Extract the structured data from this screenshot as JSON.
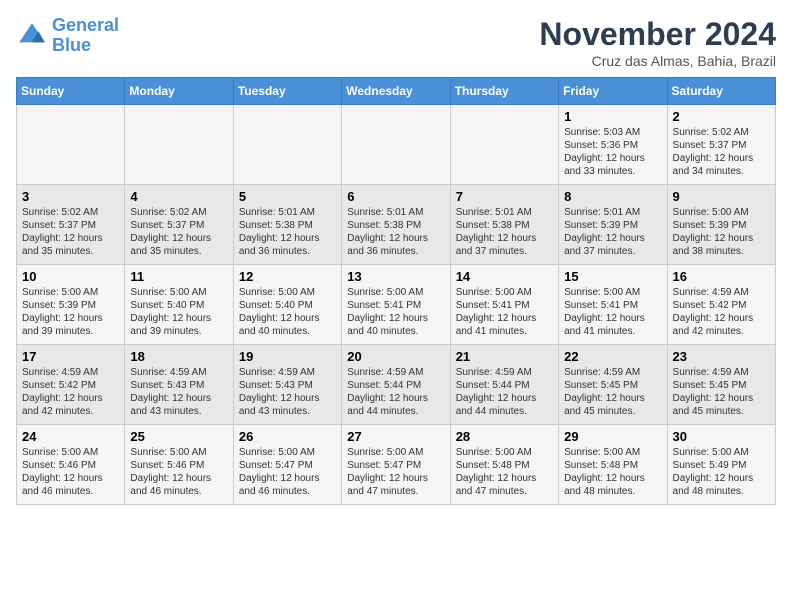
{
  "logo": {
    "line1": "General",
    "line2": "Blue"
  },
  "header": {
    "month": "November 2024",
    "location": "Cruz das Almas, Bahia, Brazil"
  },
  "weekdays": [
    "Sunday",
    "Monday",
    "Tuesday",
    "Wednesday",
    "Thursday",
    "Friday",
    "Saturday"
  ],
  "weeks": [
    [
      {
        "day": "",
        "info": ""
      },
      {
        "day": "",
        "info": ""
      },
      {
        "day": "",
        "info": ""
      },
      {
        "day": "",
        "info": ""
      },
      {
        "day": "",
        "info": ""
      },
      {
        "day": "1",
        "info": "Sunrise: 5:03 AM\nSunset: 5:36 PM\nDaylight: 12 hours and 33 minutes."
      },
      {
        "day": "2",
        "info": "Sunrise: 5:02 AM\nSunset: 5:37 PM\nDaylight: 12 hours and 34 minutes."
      }
    ],
    [
      {
        "day": "3",
        "info": "Sunrise: 5:02 AM\nSunset: 5:37 PM\nDaylight: 12 hours and 35 minutes."
      },
      {
        "day": "4",
        "info": "Sunrise: 5:02 AM\nSunset: 5:37 PM\nDaylight: 12 hours and 35 minutes."
      },
      {
        "day": "5",
        "info": "Sunrise: 5:01 AM\nSunset: 5:38 PM\nDaylight: 12 hours and 36 minutes."
      },
      {
        "day": "6",
        "info": "Sunrise: 5:01 AM\nSunset: 5:38 PM\nDaylight: 12 hours and 36 minutes."
      },
      {
        "day": "7",
        "info": "Sunrise: 5:01 AM\nSunset: 5:38 PM\nDaylight: 12 hours and 37 minutes."
      },
      {
        "day": "8",
        "info": "Sunrise: 5:01 AM\nSunset: 5:39 PM\nDaylight: 12 hours and 37 minutes."
      },
      {
        "day": "9",
        "info": "Sunrise: 5:00 AM\nSunset: 5:39 PM\nDaylight: 12 hours and 38 minutes."
      }
    ],
    [
      {
        "day": "10",
        "info": "Sunrise: 5:00 AM\nSunset: 5:39 PM\nDaylight: 12 hours and 39 minutes."
      },
      {
        "day": "11",
        "info": "Sunrise: 5:00 AM\nSunset: 5:40 PM\nDaylight: 12 hours and 39 minutes."
      },
      {
        "day": "12",
        "info": "Sunrise: 5:00 AM\nSunset: 5:40 PM\nDaylight: 12 hours and 40 minutes."
      },
      {
        "day": "13",
        "info": "Sunrise: 5:00 AM\nSunset: 5:41 PM\nDaylight: 12 hours and 40 minutes."
      },
      {
        "day": "14",
        "info": "Sunrise: 5:00 AM\nSunset: 5:41 PM\nDaylight: 12 hours and 41 minutes."
      },
      {
        "day": "15",
        "info": "Sunrise: 5:00 AM\nSunset: 5:41 PM\nDaylight: 12 hours and 41 minutes."
      },
      {
        "day": "16",
        "info": "Sunrise: 4:59 AM\nSunset: 5:42 PM\nDaylight: 12 hours and 42 minutes."
      }
    ],
    [
      {
        "day": "17",
        "info": "Sunrise: 4:59 AM\nSunset: 5:42 PM\nDaylight: 12 hours and 42 minutes."
      },
      {
        "day": "18",
        "info": "Sunrise: 4:59 AM\nSunset: 5:43 PM\nDaylight: 12 hours and 43 minutes."
      },
      {
        "day": "19",
        "info": "Sunrise: 4:59 AM\nSunset: 5:43 PM\nDaylight: 12 hours and 43 minutes."
      },
      {
        "day": "20",
        "info": "Sunrise: 4:59 AM\nSunset: 5:44 PM\nDaylight: 12 hours and 44 minutes."
      },
      {
        "day": "21",
        "info": "Sunrise: 4:59 AM\nSunset: 5:44 PM\nDaylight: 12 hours and 44 minutes."
      },
      {
        "day": "22",
        "info": "Sunrise: 4:59 AM\nSunset: 5:45 PM\nDaylight: 12 hours and 45 minutes."
      },
      {
        "day": "23",
        "info": "Sunrise: 4:59 AM\nSunset: 5:45 PM\nDaylight: 12 hours and 45 minutes."
      }
    ],
    [
      {
        "day": "24",
        "info": "Sunrise: 5:00 AM\nSunset: 5:46 PM\nDaylight: 12 hours and 46 minutes."
      },
      {
        "day": "25",
        "info": "Sunrise: 5:00 AM\nSunset: 5:46 PM\nDaylight: 12 hours and 46 minutes."
      },
      {
        "day": "26",
        "info": "Sunrise: 5:00 AM\nSunset: 5:47 PM\nDaylight: 12 hours and 46 minutes."
      },
      {
        "day": "27",
        "info": "Sunrise: 5:00 AM\nSunset: 5:47 PM\nDaylight: 12 hours and 47 minutes."
      },
      {
        "day": "28",
        "info": "Sunrise: 5:00 AM\nSunset: 5:48 PM\nDaylight: 12 hours and 47 minutes."
      },
      {
        "day": "29",
        "info": "Sunrise: 5:00 AM\nSunset: 5:48 PM\nDaylight: 12 hours and 48 minutes."
      },
      {
        "day": "30",
        "info": "Sunrise: 5:00 AM\nSunset: 5:49 PM\nDaylight: 12 hours and 48 minutes."
      }
    ]
  ]
}
